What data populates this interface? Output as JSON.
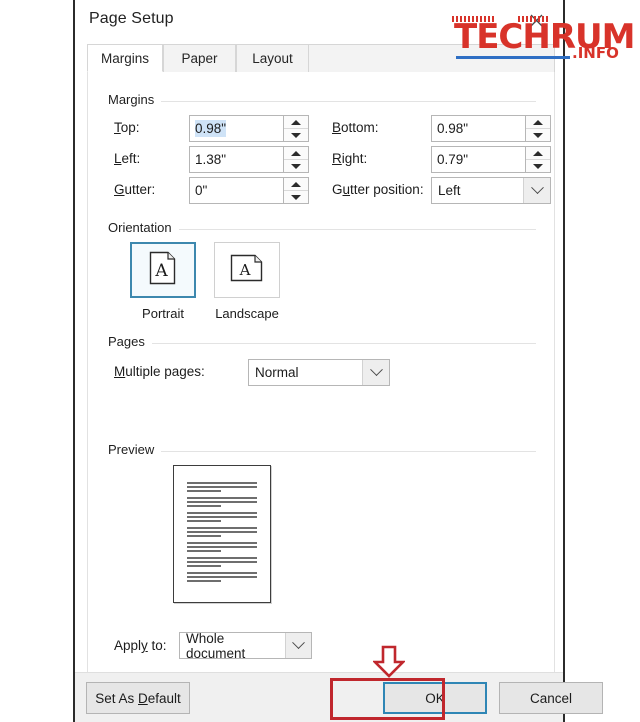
{
  "dialog": {
    "title": "Page Setup",
    "close_icon": "close-icon"
  },
  "tabs": [
    {
      "label": "Margins",
      "active": true
    },
    {
      "label": "Paper",
      "active": false
    },
    {
      "label": "Layout",
      "active": false
    }
  ],
  "margins": {
    "group_label": "Margins",
    "top": {
      "label_pre": "T",
      "label_acc": "o",
      "label_post": "p:",
      "label": "Top:",
      "value": "0.98\"",
      "selected": true
    },
    "bottom": {
      "label": "Bottom:",
      "value": "0.98\""
    },
    "left": {
      "label": "Left:",
      "value": "1.38\""
    },
    "right": {
      "label": "Right:",
      "value": "0.79\""
    },
    "gutter": {
      "label": "Gutter:",
      "value": "0\""
    },
    "gutter_position": {
      "label": "Gutter position:",
      "value": "Left"
    }
  },
  "orientation": {
    "group_label": "Orientation",
    "options": [
      {
        "label": "Portrait",
        "selected": true,
        "icon": "page-portrait-icon"
      },
      {
        "label": "Landscape",
        "selected": false,
        "icon": "page-landscape-icon"
      }
    ]
  },
  "pages": {
    "group_label": "Pages",
    "multiple_pages": {
      "label": "Multiple pages:",
      "value": "Normal"
    }
  },
  "preview": {
    "group_label": "Preview",
    "paragraph_count": 7,
    "lines_per_paragraph": 3
  },
  "apply": {
    "label": "Apply to:",
    "value": "Whole document"
  },
  "footer": {
    "set_as_default": "Set As Default",
    "ok": "OK",
    "cancel": "Cancel"
  },
  "annotations": {
    "highlight_color": "#c0272d",
    "arrow_target": "OK",
    "rect_target": "OK"
  },
  "watermark": {
    "brand": "TECHRUM",
    "suffix": ".INFO",
    "brand_color": "#d8332a",
    "rule_color": "#2f6fc4"
  }
}
